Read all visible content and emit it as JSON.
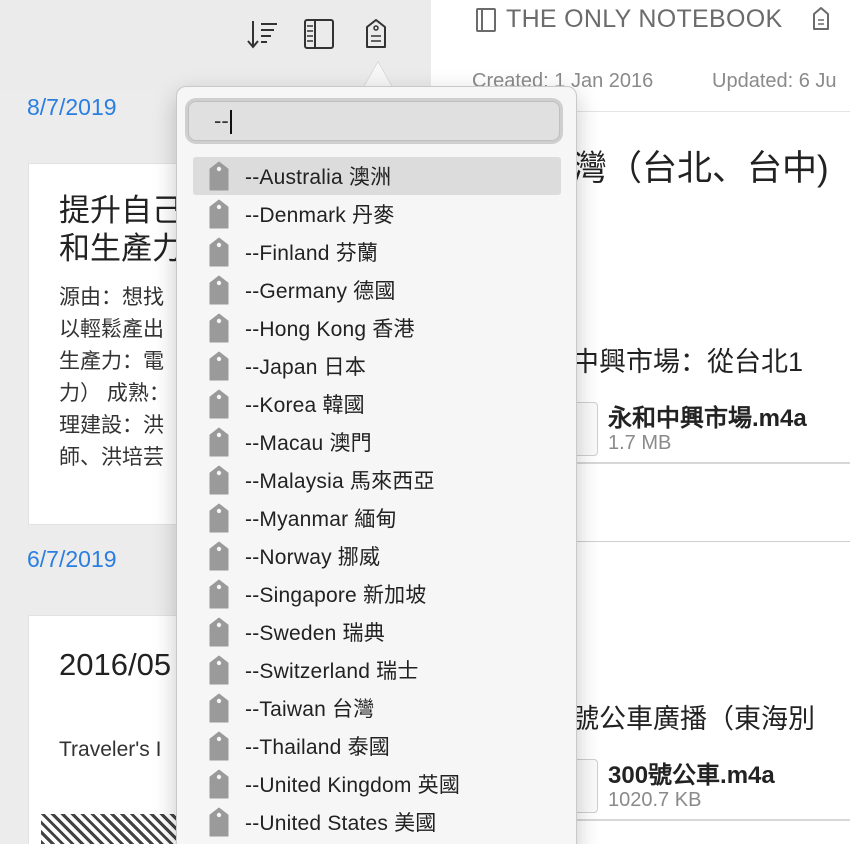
{
  "toolbar": {
    "icons": [
      "sort-icon",
      "sidebar-layout-icon",
      "tag-icon"
    ]
  },
  "notes": [
    {
      "date": "8/7/2019",
      "title_lines": [
        "提升自己",
        "和生產力"
      ],
      "body_lines": [
        "源由：想找",
        "以輕鬆產出",
        "生產力：電",
        "力） 成熟：",
        "理建設：洪",
        "師、洪培芸"
      ]
    },
    {
      "date": "6/7/2019",
      "title": "2016/05",
      "body": "Traveler's I"
    }
  ],
  "detail": {
    "notebook": "THE ONLY NOTEBOOK",
    "created": "Created: 1 Jan 2016",
    "updated": "Updated: 6 Ju",
    "heading": "灣（台北、台中)",
    "sections": [
      {
        "title": "中興市場：從台北1",
        "attachment": {
          "name": "永和中興市場.m4a",
          "size": "1.7 MB"
        }
      },
      {
        "title": "號公車廣播（東海別",
        "attachment": {
          "name": "300號公車.m4a",
          "size": "1020.7 KB"
        }
      }
    ]
  },
  "tag_popover": {
    "search_value": "--",
    "selected_index": 0,
    "tags": [
      "--Australia 澳洲",
      "--Denmark 丹麥",
      "--Finland 芬蘭",
      "--Germany 德國",
      "--Hong Kong 香港",
      "--Japan 日本",
      "--Korea 韓國",
      "--Macau 澳門",
      "--Malaysia 馬來西亞",
      "--Myanmar 緬甸",
      "--Norway 挪威",
      "--Singapore 新加坡",
      "--Sweden 瑞典",
      "--Switzerland 瑞士",
      "--Taiwan 台灣",
      "--Thailand 泰國",
      "--United Kingdom 英國",
      "--United States 美國"
    ]
  },
  "colors": {
    "date_blue": "#2a7ee0",
    "selected_row": "#dcdcdc",
    "tag_gray": "#9a9a9a"
  }
}
